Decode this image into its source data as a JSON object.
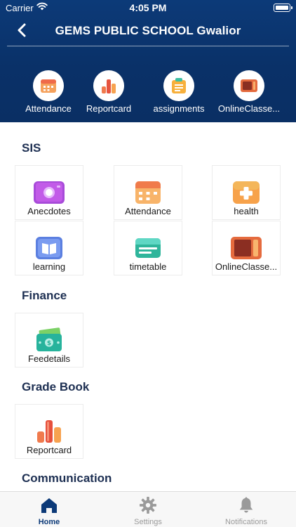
{
  "status_bar": {
    "carrier": "Carrier",
    "time": "4:05 PM"
  },
  "header": {
    "title": "GEMS PUBLIC SCHOOL Gwalior"
  },
  "quick_actions": [
    {
      "label": "Attendance",
      "icon": "calendar-icon"
    },
    {
      "label": "Reportcard",
      "icon": "bar-chart-icon"
    },
    {
      "label": "assignments",
      "icon": "clipboard-icon"
    },
    {
      "label": "OnlineClasse...",
      "icon": "tablet-icon"
    }
  ],
  "sections": {
    "sis": {
      "title": "SIS",
      "tiles": [
        {
          "label": "Anecdotes",
          "icon": "camera-icon"
        },
        {
          "label": "Attendance",
          "icon": "calendar-icon"
        },
        {
          "label": "health",
          "icon": "health-cross-icon"
        },
        {
          "label": "learning",
          "icon": "book-icon"
        },
        {
          "label": "timetable",
          "icon": "timetable-icon"
        },
        {
          "label": "OnlineClasse...",
          "icon": "tablet-icon"
        }
      ]
    },
    "finance": {
      "title": "Finance",
      "tiles": [
        {
          "label": "Feedetails",
          "icon": "money-icon"
        }
      ]
    },
    "grade_book": {
      "title": "Grade Book",
      "tiles": [
        {
          "label": "Reportcard",
          "icon": "bar-chart-icon"
        }
      ]
    },
    "communication": {
      "title": "Communication"
    }
  },
  "tabbar": {
    "home": "Home",
    "settings": "Settings",
    "notifications": "Notifications"
  },
  "colors": {
    "header_bg": "#0c3a78",
    "active_tab": "#0c3a78",
    "inactive_tab": "#9a9a9a"
  }
}
